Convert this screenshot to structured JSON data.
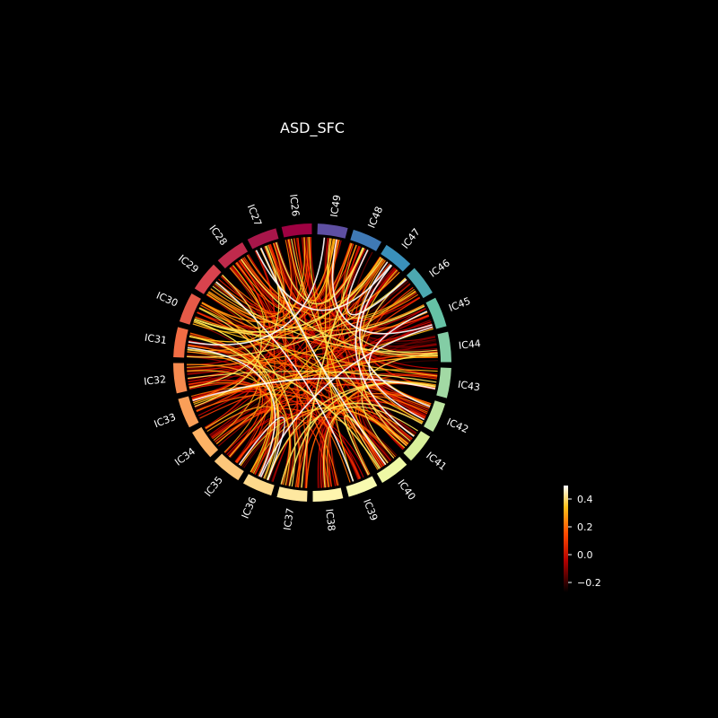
{
  "title": "ASD_SFC",
  "nodes": [
    {
      "label": "IC26",
      "color": "#9e0142"
    },
    {
      "label": "IC27",
      "color": "#a8164a"
    },
    {
      "label": "IC28",
      "color": "#c02a4c"
    },
    {
      "label": "IC29",
      "color": "#d8434e"
    },
    {
      "label": "IC30",
      "color": "#e55a48"
    },
    {
      "label": "IC31",
      "color": "#f26d44"
    },
    {
      "label": "IC32",
      "color": "#f68a4f"
    },
    {
      "label": "IC33",
      "color": "#fa9f58"
    },
    {
      "label": "IC34",
      "color": "#fdb365"
    },
    {
      "label": "IC35",
      "color": "#fdc77a"
    },
    {
      "label": "IC36",
      "color": "#fed98b"
    },
    {
      "label": "IC37",
      "color": "#fee8a0"
    },
    {
      "label": "IC38",
      "color": "#fff5ae"
    },
    {
      "label": "IC39",
      "color": "#f8fbb0"
    },
    {
      "label": "IC40",
      "color": "#eef8a5"
    },
    {
      "label": "IC41",
      "color": "#d9f09b"
    },
    {
      "label": "IC42",
      "color": "#bde5a0"
    },
    {
      "label": "IC43",
      "color": "#a2d9a4"
    },
    {
      "label": "IC44",
      "color": "#83cda5"
    },
    {
      "label": "IC45",
      "color": "#66c2a5"
    },
    {
      "label": "IC46",
      "color": "#4ca8b0"
    },
    {
      "label": "IC47",
      "color": "#3a91bb"
    },
    {
      "label": "IC48",
      "color": "#3f79b5"
    },
    {
      "label": "IC49",
      "color": "#5e4fa2"
    }
  ],
  "colorbar": {
    "ticks": [
      "0.4",
      "0.2",
      "0.0",
      "−0.2"
    ]
  }
}
